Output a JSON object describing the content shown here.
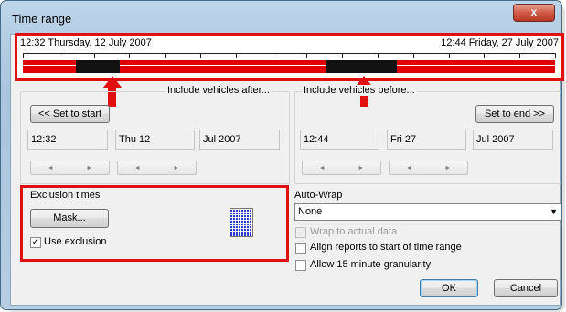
{
  "window": {
    "title": "Time range",
    "close_label": "x"
  },
  "timeline": {
    "start_label": "12:32 Thursday, 12 July 2007",
    "end_label": "12:44 Friday, 27 July 2007"
  },
  "after_group": {
    "label": "Include vehicles after...",
    "set_button": "<< Set to start",
    "time": "12:32",
    "day": "Thu 12",
    "month": "Jul 2007"
  },
  "before_group": {
    "label": "Include vehicles before...",
    "set_button": "Set to end >>",
    "time": "12:44",
    "day": "Fri 27",
    "month": "Jul 2007"
  },
  "spin": {
    "left": "◄",
    "right": "►"
  },
  "exclusion": {
    "label": "Exclusion times",
    "mask_button": "Mask...",
    "use_label": "Use exclusion",
    "use_checked": "✓"
  },
  "autowrap": {
    "label": "Auto-Wrap",
    "value": "None",
    "dropdown_arrow": "▼",
    "wrap_actual": "Wrap to actual data",
    "align_reports": "Align reports to start of time range",
    "allow_15": "Allow 15 minute granularity"
  },
  "footer": {
    "ok": "OK",
    "cancel": "Cancel"
  }
}
